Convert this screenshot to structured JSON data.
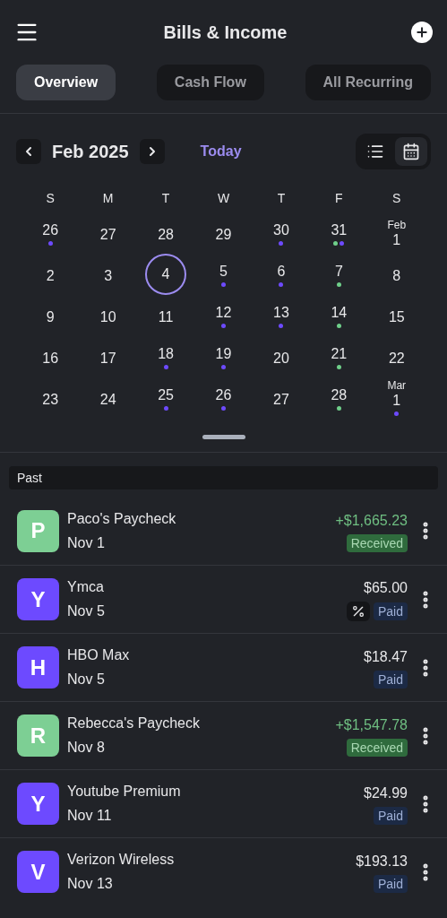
{
  "header": {
    "title": "Bills & Income"
  },
  "tabs": [
    {
      "label": "Overview",
      "selected": true
    },
    {
      "label": "Cash Flow",
      "selected": false
    },
    {
      "label": "All Recurring",
      "selected": false
    }
  ],
  "calendar": {
    "month": "Feb 2025",
    "today_button": "Today",
    "view_toggle": [
      {
        "kind": "list",
        "selected": false
      },
      {
        "kind": "calendar",
        "selected": true
      }
    ],
    "weekdays": [
      "S",
      "M",
      "T",
      "W",
      "T",
      "F",
      "S"
    ],
    "days": [
      {
        "day": "26",
        "dots": [
          {
            "color": "#6d4aff"
          }
        ]
      },
      {
        "day": "27"
      },
      {
        "day": "28"
      },
      {
        "day": "29"
      },
      {
        "day": "30",
        "dots": [
          {
            "color": "#6d4aff"
          }
        ]
      },
      {
        "day": "31",
        "dots": [
          {
            "color": "#6fcf8a"
          },
          {
            "color": "#6d4aff"
          }
        ]
      },
      {
        "month_label": "Feb",
        "day": "1"
      },
      {
        "day": "2"
      },
      {
        "day": "3"
      },
      {
        "day": "4",
        "selected": true
      },
      {
        "day": "5",
        "dots": [
          {
            "color": "#6d4aff"
          }
        ]
      },
      {
        "day": "6",
        "dots": [
          {
            "color": "#6d4aff"
          }
        ]
      },
      {
        "day": "7",
        "dots": [
          {
            "color": "#6fcf8a"
          }
        ]
      },
      {
        "day": "8"
      },
      {
        "day": "9"
      },
      {
        "day": "10"
      },
      {
        "day": "11"
      },
      {
        "day": "12",
        "dots": [
          {
            "color": "#6d4aff"
          }
        ]
      },
      {
        "day": "13",
        "dots": [
          {
            "color": "#6d4aff"
          }
        ]
      },
      {
        "day": "14",
        "dots": [
          {
            "color": "#6fcf8a"
          }
        ]
      },
      {
        "day": "15"
      },
      {
        "day": "16"
      },
      {
        "day": "17"
      },
      {
        "day": "18",
        "dots": [
          {
            "color": "#6d4aff"
          }
        ]
      },
      {
        "day": "19",
        "dots": [
          {
            "color": "#6d4aff"
          }
        ]
      },
      {
        "day": "20"
      },
      {
        "day": "21",
        "dots": [
          {
            "color": "#6fcf8a"
          }
        ]
      },
      {
        "day": "22"
      },
      {
        "day": "23"
      },
      {
        "day": "24"
      },
      {
        "day": "25",
        "dots": [
          {
            "color": "#6d4aff"
          }
        ]
      },
      {
        "day": "26",
        "dots": [
          {
            "color": "#6d4aff"
          }
        ]
      },
      {
        "day": "27"
      },
      {
        "day": "28",
        "dots": [
          {
            "color": "#6fcf8a"
          }
        ]
      },
      {
        "month_label": "Mar",
        "day": "1",
        "dots": [
          {
            "color": "#6d4aff"
          }
        ]
      }
    ]
  },
  "section": {
    "title": "Past"
  },
  "items": [
    {
      "initial": "P",
      "color": "#7dcf94",
      "name": "Paco's Paycheck",
      "date": "Nov 1",
      "amount": "+$1,665.23",
      "kind": "income",
      "status": "Received",
      "split_icon": false
    },
    {
      "initial": "Y",
      "color": "#6d4aff",
      "name": "Ymca",
      "date": "Nov 5",
      "amount": "$65.00",
      "kind": "bill",
      "status": "Paid",
      "split_icon": true
    },
    {
      "initial": "H",
      "color": "#6d4aff",
      "name": "HBO Max",
      "date": "Nov 5",
      "amount": "$18.47",
      "kind": "bill",
      "status": "Paid",
      "split_icon": false
    },
    {
      "initial": "R",
      "color": "#7dcf94",
      "name": "Rebecca's Paycheck",
      "date": "Nov 8",
      "amount": "+$1,547.78",
      "kind": "income",
      "status": "Received",
      "split_icon": false
    },
    {
      "initial": "Y",
      "color": "#6d4aff",
      "name": "Youtube Premium",
      "date": "Nov 11",
      "amount": "$24.99",
      "kind": "bill",
      "status": "Paid",
      "split_icon": false
    },
    {
      "initial": "V",
      "color": "#6d4aff",
      "name": "Verizon Wireless",
      "date": "Nov 13",
      "amount": "$193.13",
      "kind": "bill",
      "status": "Paid",
      "split_icon": false
    }
  ]
}
